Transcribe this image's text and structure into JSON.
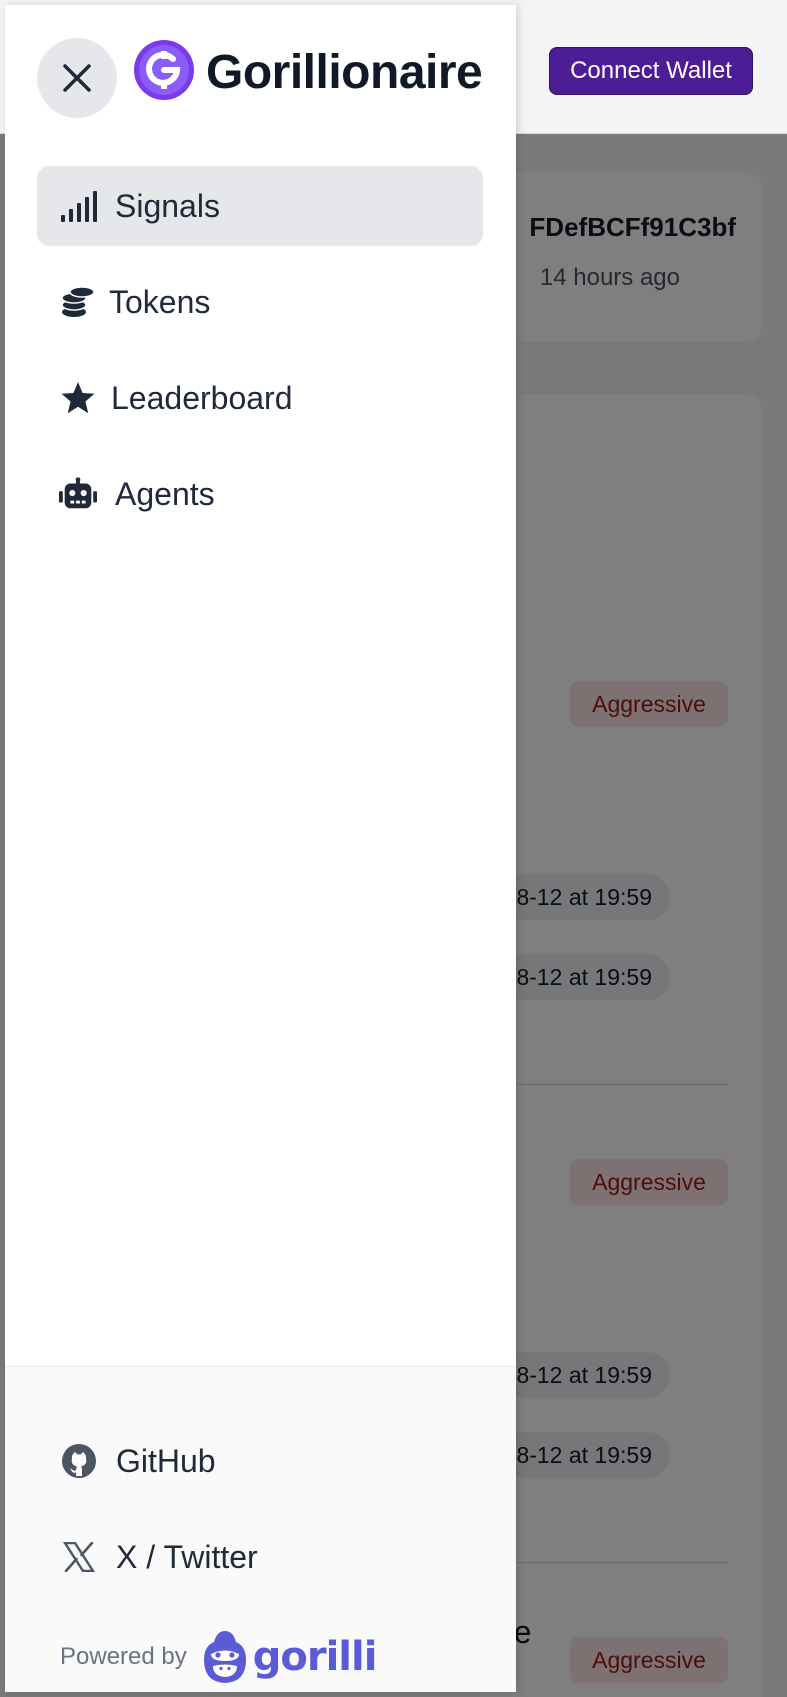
{
  "header": {
    "brand": "Gorillionaire",
    "connect_wallet_label": "Connect Wallet"
  },
  "background": {
    "address_fragment": "FDefBCFf91C3bf",
    "time_ago": "14 hours ago",
    "badges": [
      "Aggressive",
      "Aggressive",
      "Aggressive"
    ],
    "timestamps": [
      "8-12 at 19:59",
      "8-12 at 19:59",
      "8-12 at 19:59",
      "8-12 at 19:59"
    ],
    "text_fragment": "nce"
  },
  "drawer": {
    "nav": [
      {
        "label": "Signals",
        "icon": "signal-bars-icon",
        "active": true
      },
      {
        "label": "Tokens",
        "icon": "coins-icon",
        "active": false
      },
      {
        "label": "Leaderboard",
        "icon": "star-icon",
        "active": false
      },
      {
        "label": "Agents",
        "icon": "robot-icon",
        "active": false
      }
    ],
    "footer": {
      "github_label": "GitHub",
      "twitter_label": "X / Twitter",
      "powered_by_label": "Powered by",
      "powered_by_brand": "gorilli"
    }
  },
  "colors": {
    "brand_purple": "#4c1d95",
    "logo_purple": "#7c3aed",
    "gorilli_blue": "#5b5bd6",
    "badge_red_bg": "#fde2e2",
    "badge_red_text": "#991b1b"
  }
}
